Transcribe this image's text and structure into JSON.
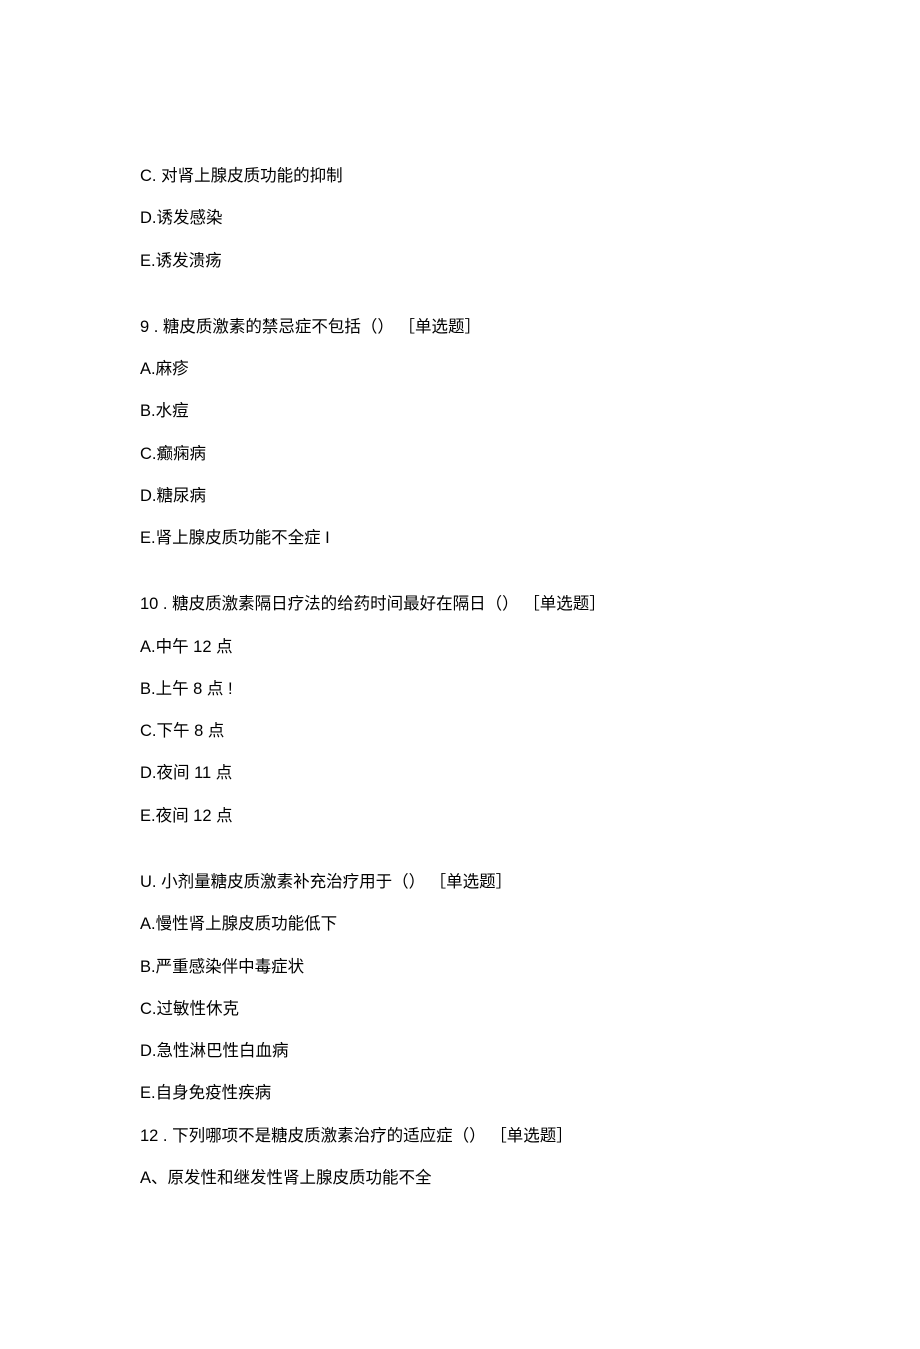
{
  "lines": [
    "C. 对肾上腺皮质功能的抑制",
    "D.诱发感染",
    "E.诱发溃疡",
    "",
    "9  . 糖皮质激素的禁忌症不包括（） ［单选题］",
    "A.麻疹",
    "B.水痘",
    "C.癫痫病",
    "D.糖尿病",
    "E.肾上腺皮质功能不全症 I",
    "",
    "10  . 糖皮质激素隔日疗法的给药时间最好在隔日（） ［单选题］",
    "A.中午 12 点",
    "B.上午 8 点 !",
    "C.下午 8 点",
    "D.夜间 11 点",
    "E.夜间 12 点",
    "",
    "U. 小剂量糖皮质激素补充治疗用于（） ［单选题］",
    "A.慢性肾上腺皮质功能低下",
    "B.严重感染伴中毒症状",
    "C.过敏性休克",
    "D.急性淋巴性白血病",
    "E.自身免疫性疾病",
    "12  . 下列哪项不是糖皮质激素治疗的适应症（） ［单选题］",
    "A、原发性和继发性肾上腺皮质功能不全"
  ]
}
